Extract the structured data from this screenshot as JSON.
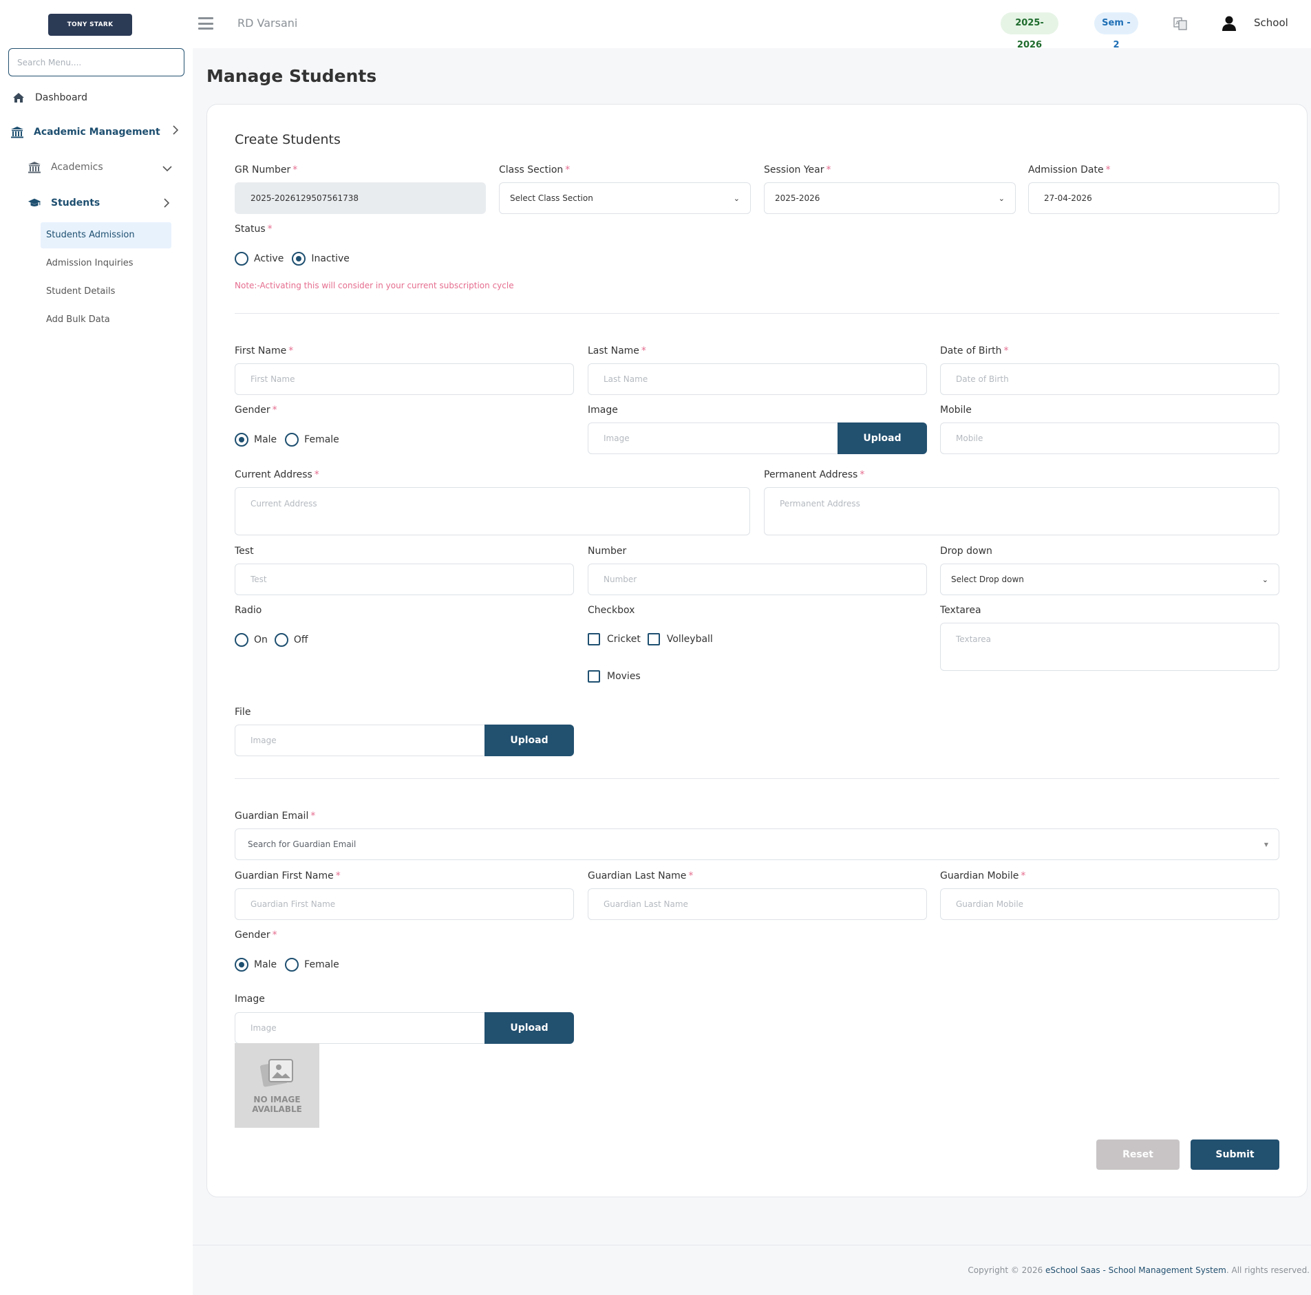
{
  "app": {
    "logo_text": "TONY STARK",
    "brand_text": "RD Varsani",
    "session_pill": "2025-2026",
    "sem_pill": "Sem - 2",
    "user_name": "School"
  },
  "sidebar": {
    "search_placeholder": "Search Menu....",
    "items": [
      {
        "label": "Dashboard"
      },
      {
        "label": "Academic Management"
      },
      {
        "label": "Academics"
      },
      {
        "label": "Students"
      }
    ],
    "sub_items": [
      {
        "label": "Students Admission"
      },
      {
        "label": "Admission Inquiries"
      },
      {
        "label": "Student Details"
      },
      {
        "label": "Add Bulk Data"
      }
    ]
  },
  "page": {
    "title": "Manage Students",
    "card_title": "Create Students"
  },
  "form": {
    "gr_number": {
      "label": "GR Number",
      "value": "2025-2026129507561738"
    },
    "class_section": {
      "label": "Class Section",
      "value": "Select Class Section"
    },
    "session_year": {
      "label": "Session Year",
      "value": "2025-2026"
    },
    "admission_date": {
      "label": "Admission Date",
      "value": "27-04-2026"
    },
    "status": {
      "label": "Status",
      "options": [
        "Active",
        "Inactive"
      ],
      "selected": "Inactive"
    },
    "note": "Note:-Activating this will consider in your current subscription cycle",
    "first_name": {
      "label": "First Name",
      "placeholder": "First Name"
    },
    "last_name": {
      "label": "Last Name",
      "placeholder": "Last Name"
    },
    "dob": {
      "label": "Date of Birth",
      "placeholder": "Date of Birth"
    },
    "gender": {
      "label": "Gender",
      "options": [
        "Male",
        "Female"
      ],
      "selected": "Male"
    },
    "image": {
      "label": "Image",
      "placeholder": "Image",
      "button": "Upload"
    },
    "mobile": {
      "label": "Mobile",
      "placeholder": "Mobile"
    },
    "current_address": {
      "label": "Current Address",
      "placeholder": "Current Address"
    },
    "permanent_address": {
      "label": "Permanent Address",
      "placeholder": "Permanent Address"
    },
    "test": {
      "label": "Test",
      "placeholder": "Test"
    },
    "number": {
      "label": "Number",
      "placeholder": "Number"
    },
    "dropdown": {
      "label": "Drop down",
      "value": "Select Drop down"
    },
    "radio": {
      "label": "Radio",
      "options": [
        "On",
        "Off"
      ]
    },
    "checkbox": {
      "label": "Checkbox",
      "options": [
        "Cricket",
        "Volleyball",
        "Movies"
      ]
    },
    "textarea": {
      "label": "Textarea",
      "placeholder": "Textarea"
    },
    "file": {
      "label": "File",
      "placeholder": "Image",
      "button": "Upload"
    },
    "guardian_email": {
      "label": "Guardian Email",
      "placeholder": "Search for Guardian Email"
    },
    "guardian_first_name": {
      "label": "Guardian First Name",
      "placeholder": "Guardian First Name"
    },
    "guardian_last_name": {
      "label": "Guardian Last Name",
      "placeholder": "Guardian Last Name"
    },
    "guardian_mobile": {
      "label": "Guardian Mobile",
      "placeholder": "Guardian Mobile"
    },
    "guardian_gender": {
      "label": "Gender",
      "options": [
        "Male",
        "Female"
      ],
      "selected": "Male"
    },
    "guardian_image": {
      "label": "Image",
      "placeholder": "Image",
      "button": "Upload",
      "no_image_line1": "NO IMAGE",
      "no_image_line2": "AVAILABLE"
    },
    "reset_button": "Reset",
    "submit_button": "Submit"
  },
  "footer": {
    "prefix": "Copyright © 2026 ",
    "link": "eSchool Saas - School Management System",
    "suffix": ". All rights reserved."
  },
  "colors": {
    "primary": "#22506f",
    "required": "#e56d8f",
    "session_pill_bg": "#e6f4e6",
    "sem_pill_bg": "#e3f0fc"
  }
}
